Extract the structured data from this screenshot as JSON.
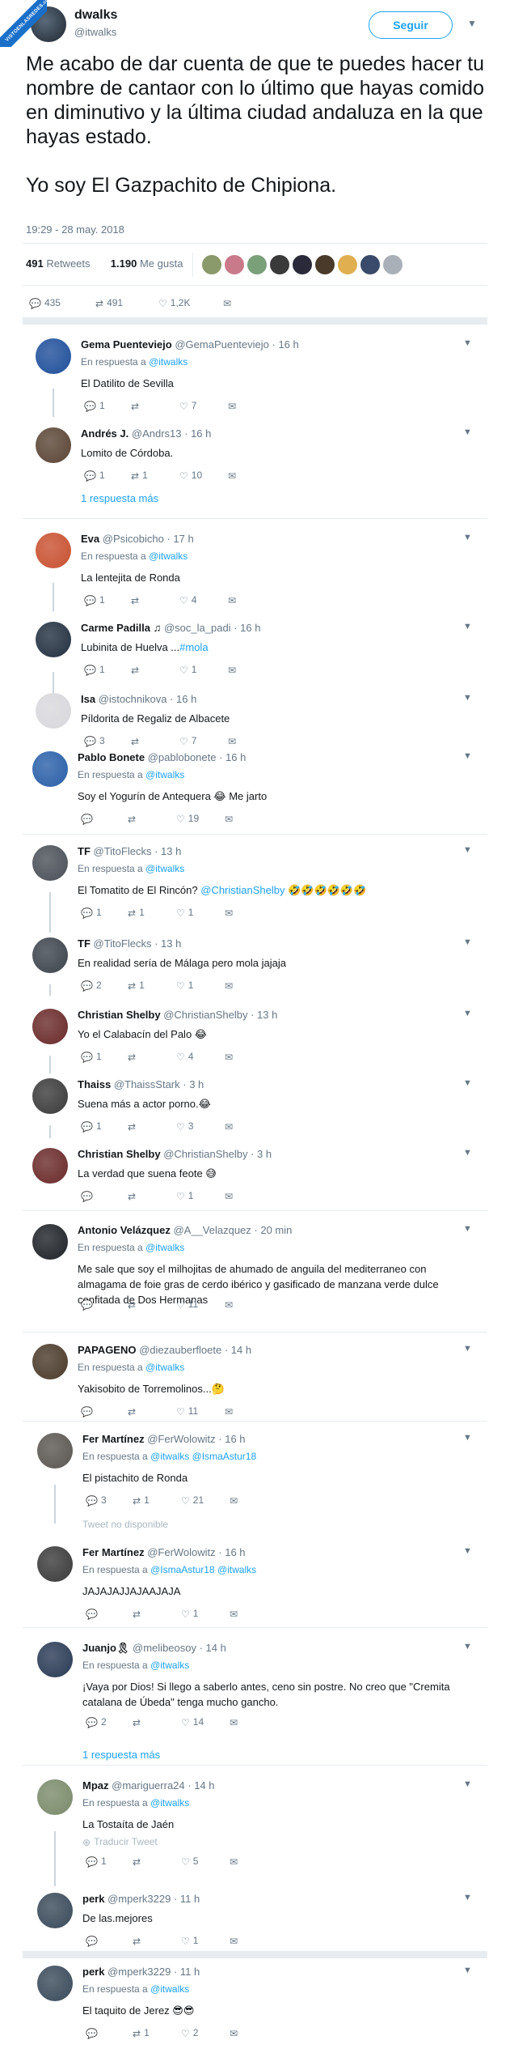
{
  "watermark": {
    "text": "VISTOENLASREDES.com"
  },
  "main": {
    "name": "dwalks",
    "handle": "@itwalks",
    "follow_label": "Seguir",
    "text_1": "Me acabo de dar cuenta de que te puedes hacer tu nombre de cantaor con lo último que hayas comido en diminutivo y la última ciudad andaluza en la que hayas estado.",
    "text_2": "Yo soy El Gazpachito de Chipiona.",
    "timestamp": "19:29 - 28 may. 2018",
    "retweets_count": "491",
    "retweets_label": "Retweets",
    "likes_count": "1.190",
    "likes_label": "Me gusta",
    "replies": "435",
    "retweets": "491",
    "likes": "1,2K"
  },
  "colors": {
    "accent": "#1da1f2",
    "muted": "#657786",
    "border": "#e6ecf0"
  },
  "labels": {
    "in_reply_to": "En respuesta a",
    "one_reply": "1 respuesta más",
    "translate": "Traducir Tweet",
    "unavailable": "Tweet no disponible"
  },
  "replies": [
    {
      "name": "Gema Puenteviejo",
      "handle": "@GemaPuenteviejo",
      "time": "· 16 h",
      "reply_to": "@itwalks",
      "text": "El Datilito de Sevilla",
      "replies": "1",
      "retweets": "",
      "likes": "7"
    },
    {
      "name": "Andrés J.",
      "handle": "@Andrs13",
      "time": "· 16 h",
      "reply_to": "",
      "text": "Lomito de Córdoba.",
      "replies": "1",
      "retweets": "1",
      "likes": "10"
    },
    {
      "name": "Eva",
      "handle": "@Psicobicho",
      "time": "· 17 h",
      "reply_to": "@itwalks",
      "text": "La lentejita de Ronda",
      "replies": "1",
      "retweets": "",
      "likes": "4"
    },
    {
      "name": "Carme Padilla ♫",
      "handle": "@soc_la_padi",
      "time": "· 16 h",
      "reply_to": "",
      "text": "Lubinita de Huelva ...",
      "hashtag": "#mola",
      "replies": "1",
      "retweets": "",
      "likes": "1"
    },
    {
      "name": "Isa",
      "handle": "@istochnikova",
      "time": "· 16 h",
      "reply_to": "",
      "text": "Píldorita de Regaliz de Albacete",
      "replies": "3",
      "retweets": "",
      "likes": "7"
    },
    {
      "name": "Pablo Bonete",
      "handle": "@pablobonete",
      "time": "· 16 h",
      "reply_to": "@itwalks",
      "text": "Soy el Yogurín de Antequera 😂 Me jarto",
      "replies": "",
      "retweets": "",
      "likes": "19"
    },
    {
      "name": "TF",
      "handle": "@TitoFlecks",
      "time": "· 13 h",
      "reply_to": "@itwalks",
      "text": "El Tomatito de El Rincón? ",
      "mention": "@ChristianShelby",
      "emoji": "🤣🤣🤣🤣🤣🤣",
      "replies": "1",
      "retweets": "1",
      "likes": "1"
    },
    {
      "name": "TF",
      "handle": "@TitoFlecks",
      "time": "· 13 h",
      "reply_to": "",
      "text": "En realidad sería de Málaga pero mola jajaja",
      "replies": "2",
      "retweets": "1",
      "likes": "1"
    },
    {
      "name": "Christian Shelby",
      "handle": "@ChristianShelby",
      "time": "· 13 h",
      "reply_to": "",
      "text": "Yo el Calabacín del Palo 😂",
      "replies": "1",
      "retweets": "",
      "likes": "4"
    },
    {
      "name": "Thaiss",
      "handle": "@ThaissStark",
      "time": "· 3 h",
      "reply_to": "",
      "text": "Suena más a actor porno.😂",
      "replies": "1",
      "retweets": "",
      "likes": "3"
    },
    {
      "name": "Christian Shelby",
      "handle": "@ChristianShelby",
      "time": "· 3 h",
      "reply_to": "",
      "text": "La verdad que suena feote 😅",
      "replies": "",
      "retweets": "",
      "likes": "1"
    },
    {
      "name": "Antonio Velázquez",
      "handle": "@A__Velazquez",
      "time": "· 20 min",
      "reply_to": "@itwalks",
      "text": "Me sale que soy el milhojitas de ahumado de anguila del mediterraneo con almagama de foie gras de cerdo ibérico y gasificado de manzana verde dulce confitada de Dos Hermanas",
      "replies": "",
      "retweets": "",
      "likes": "11"
    },
    {
      "name": "PAPAGENO",
      "handle": "@diezauberfloete",
      "time": "· 14 h",
      "reply_to": "@itwalks",
      "text": "Yakisobito de Torremolinos...🤔",
      "replies": "",
      "retweets": "",
      "likes": "11"
    },
    {
      "name": "Fer Martínez",
      "handle": "@FerWolowitz",
      "time": "· 16 h",
      "reply_to": "@itwalks @IsmaAstur18",
      "text": "El pistachito de Ronda",
      "replies": "3",
      "retweets": "1",
      "likes": "21"
    },
    {
      "name": "Fer Martínez",
      "handle": "@FerWolowitz",
      "time": "· 16 h",
      "reply_to": "@IsmaAstur18 @itwalks",
      "text": "JAJAJAJJAJAAJAJA",
      "replies": "",
      "retweets": "",
      "likes": "1"
    },
    {
      "name": "Juanjo🎗",
      "handle": "@melibeosoy",
      "time": "· 14 h",
      "reply_to": "@itwalks",
      "text": "¡Vaya por Dios! Si llego a saberlo antes, ceno sin postre. No creo que \"Cremita catalana de Úbeda\" tenga mucho gancho.",
      "replies": "2",
      "retweets": "",
      "likes": "14"
    },
    {
      "name": "Mpaz",
      "handle": "@mariguerra24",
      "time": "· 14 h",
      "reply_to": "@itwalks",
      "text": "La Tostaíta de Jaén",
      "replies": "1",
      "retweets": "",
      "likes": "5"
    },
    {
      "name": "perk",
      "handle": "@mperk3229",
      "time": "· 11 h",
      "reply_to": "",
      "text": "De las.mejores",
      "replies": "",
      "retweets": "",
      "likes": "1"
    },
    {
      "name": "perk",
      "handle": "@mperk3229",
      "time": "· 11 h",
      "reply_to": "@itwalks",
      "text": "El taquito de Jerez 😎😎",
      "replies": "",
      "retweets": "1",
      "likes": "2"
    }
  ]
}
